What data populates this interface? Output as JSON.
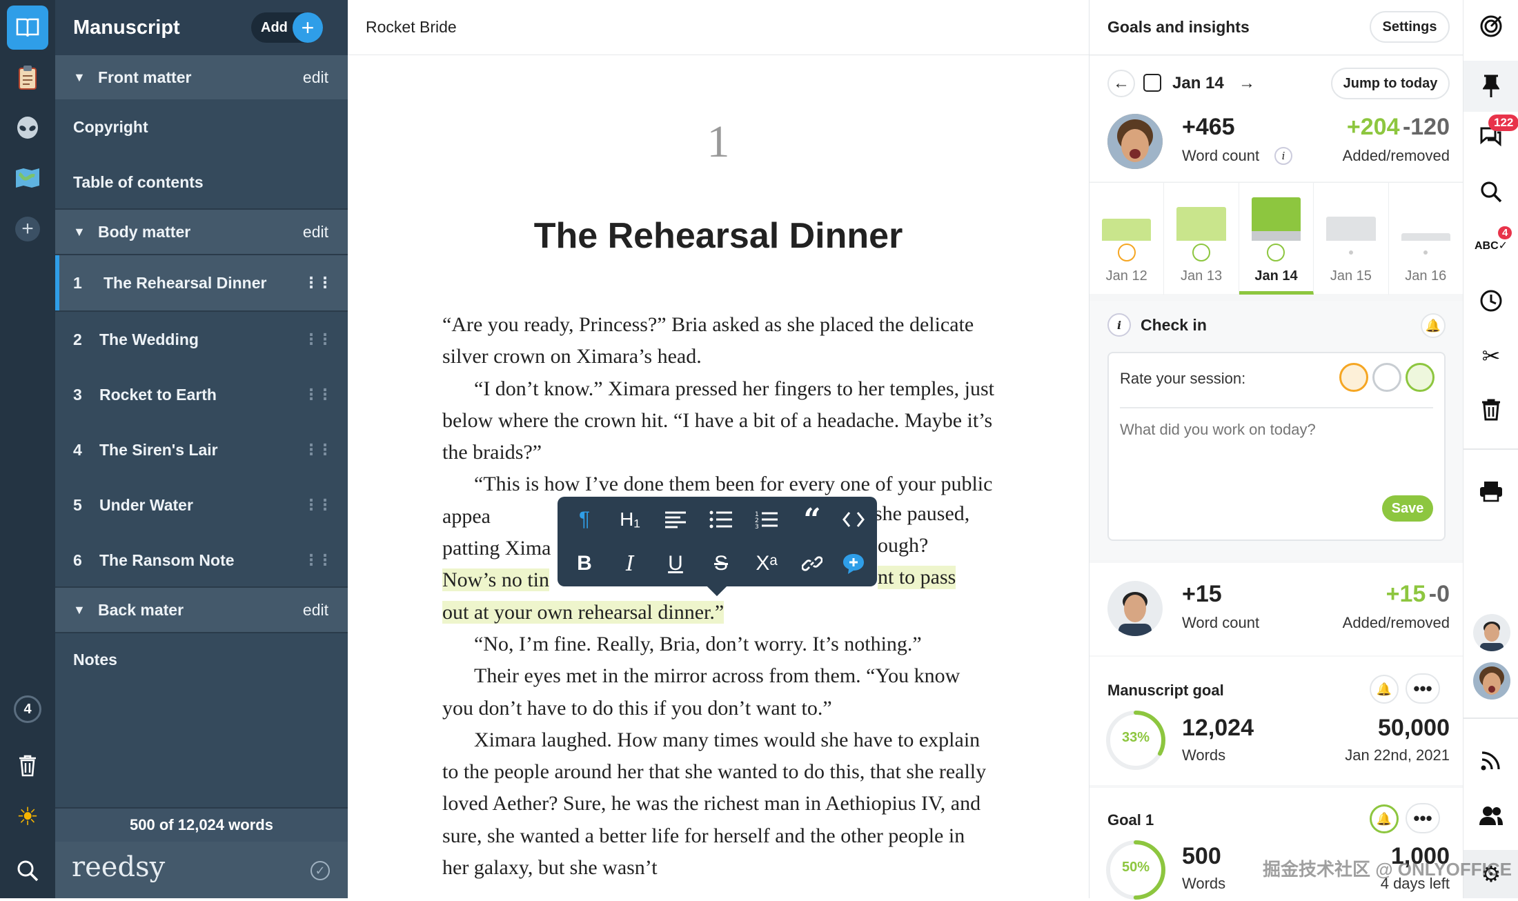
{
  "rail": {
    "count_badge": "4"
  },
  "sidebar": {
    "title": "Manuscript",
    "add_label": "Add",
    "front_matter": {
      "label": "Front matter",
      "edit": "edit"
    },
    "front_items": [
      "Copyright",
      "Table of contents"
    ],
    "body_matter": {
      "label": "Body matter",
      "edit": "edit"
    },
    "chapters": [
      {
        "num": "1",
        "title": "The Rehearsal Dinner"
      },
      {
        "num": "2",
        "title": "The Wedding"
      },
      {
        "num": "3",
        "title": "Rocket to Earth"
      },
      {
        "num": "4",
        "title": "The Siren's Lair"
      },
      {
        "num": "5",
        "title": "Under Water"
      },
      {
        "num": "6",
        "title": "The Ransom Note"
      }
    ],
    "back_matter": {
      "label": "Back mater",
      "edit": "edit"
    },
    "back_items": [
      "Notes"
    ],
    "word_total": "500 of 12,024 words",
    "brand": "reedsy"
  },
  "editor": {
    "book_title": "Rocket Bride",
    "chapter_number": "1",
    "chapter_title": "The Rehearsal Dinner",
    "paragraphs": [
      "“Are you ready, Princess?” Bria asked as she placed the delicate silver crown on Ximara’s head.",
      "“I don’t know.” Ximara pressed her fingers to her temples, just below where the crown hit. “I have a bit of a headache. Maybe it’s the braids?”",
      "“This is how I’ve done them been for every one of your public appea",
      "patting Xima",
      "Now’s no tin",
      "out at your own rehearsal dinner.”",
      "“No, I’m fine. Really, Bria, don’t worry. It’s nothing.”",
      "Their eyes met in the mirror across from them. “You know you don’t have to do this if you don’t want to.”",
      "Ximara laughed. How many times would she have to explain to the people around her that she wanted to do this, that she really loved Aether? Sure, he was the richest man in Aethiopius IV, and sure, she wanted a better life for herself and the other people in her galaxy, but she wasn’t"
    ],
    "fragments": {
      "she_paused": "she paused,",
      "rough": "ough?",
      "nt_to_pass": "nt to pass"
    }
  },
  "toolbar": {
    "row1": [
      "paragraph-icon",
      "heading-icon",
      "align-icon",
      "bullet-list-icon",
      "numbered-list-icon",
      "quote-icon",
      "code-icon"
    ],
    "row2": [
      "bold-icon",
      "italic-icon",
      "underline-icon",
      "strikethrough-icon",
      "superscript-icon",
      "link-icon",
      "comment-icon"
    ],
    "heading_glyph": "H₁",
    "superscript_glyph": "Xᵃ"
  },
  "panel": {
    "title": "Goals and insights",
    "settings_label": "Settings",
    "date": "Jan 14",
    "jump_label": "Jump to today",
    "me": {
      "word_delta": "+465",
      "word_label": "Word count",
      "added": "+204",
      "removed": "-120",
      "added_label": "Added/removed"
    },
    "days": [
      {
        "label": "Jan 12",
        "level": 0.45
      },
      {
        "label": "Jan 13",
        "level": 0.7
      },
      {
        "label": "Jan 14",
        "level": 0.9
      },
      {
        "label": "Jan 15",
        "level": 0.5
      },
      {
        "label": "Jan 16",
        "level": 0.15
      }
    ],
    "checkin": {
      "title": "Check in",
      "rate_label": "Rate your session:",
      "placeholder": "What did you work on today?",
      "save_label": "Save"
    },
    "collab": {
      "word_delta": "+15",
      "word_label": "Word count",
      "added": "+15",
      "removed": "-0",
      "added_label": "Added/removed"
    },
    "manuscript_goal": {
      "title": "Manuscript goal",
      "percent": "33%",
      "progress": 0.33,
      "words": "12,024",
      "words_label": "Words",
      "target": "50,000",
      "deadline": "Jan 22nd, 2021"
    },
    "goal1": {
      "title": "Goal 1",
      "percent": "50%",
      "progress": 0.5,
      "words": "500",
      "words_label": "Words",
      "target": "1,000",
      "deadline": "4 days left"
    }
  },
  "rrail": {
    "comments_badge": "122",
    "spell_badge": "4"
  },
  "watermark": "掘金技术社区 @ ONLYOFFICE",
  "colors": {
    "accent": "#2f9ee8",
    "green": "#8dc63f",
    "sidebar": "#354a5c",
    "rail": "#243443"
  }
}
